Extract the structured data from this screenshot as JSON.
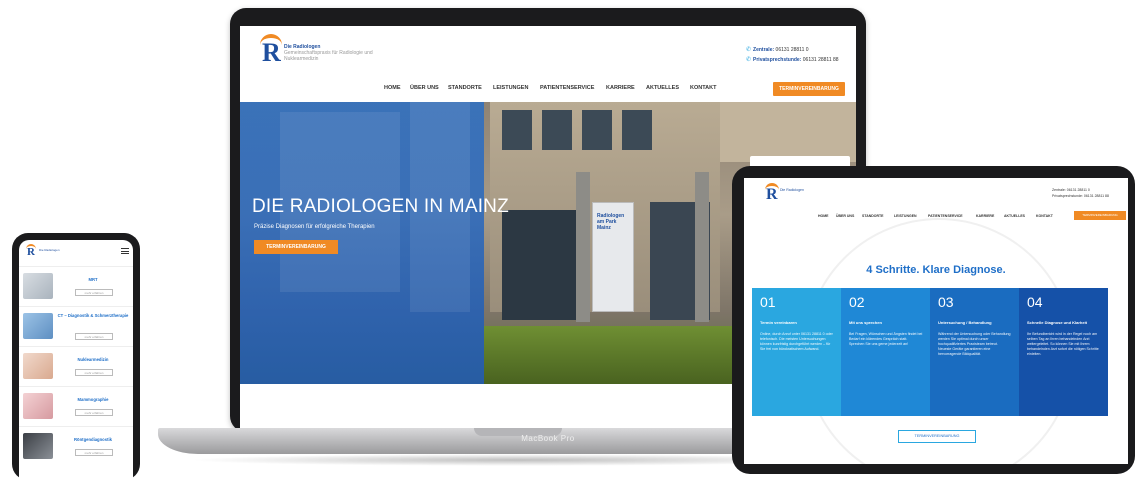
{
  "colors": {
    "brand_blue": "#1f4f9e",
    "accent_orange": "#f08a24",
    "light_blue": "#2aa7e0"
  },
  "laptop": {
    "label": "MacBook Pro",
    "logo": {
      "letter": "R",
      "name": "Die Radiologen",
      "tagline": "Gemeinschaftspraxis für Radiologie und Nuklearmedizin"
    },
    "contact": {
      "zentrale_label": "Zentrale:",
      "zentrale_number": "06131 28811 0",
      "privat_label": "Privatsprechstunde:",
      "privat_number": "06131 28811 88"
    },
    "nav": [
      "HOME",
      "ÜBER UNS",
      "STANDORTE",
      "LEISTUNGEN",
      "PATIENTENSERVICE",
      "KARRIERE",
      "AKTUELLES",
      "KONTAKT"
    ],
    "nav_cta": "TERMINVEREINBARUNG",
    "hero": {
      "title": "DIE RADIOLOGEN IN MAINZ",
      "subtitle": "Präzise Diagnosen für erfolgreiche Therapien",
      "button": "TERMINVEREINBARUNG",
      "sign_text": "Radiologen am Park Mainz"
    }
  },
  "tablet": {
    "logo": {
      "letter": "R",
      "name": "Die Radiologen"
    },
    "contact": {
      "zentrale": "Zentrale: 06131 28811 0",
      "privat": "Privatsprechstunde: 06131 28811 88"
    },
    "nav": [
      "HOME",
      "ÜBER UNS",
      "STANDORTE",
      "LEISTUNGEN",
      "PATIENTENSERVICE",
      "KARRIERE",
      "AKTUELLES",
      "KONTAKT"
    ],
    "nav_cta": "TERMINVEREINBARUNG",
    "heading": "4 Schritte. Klare Diagnose.",
    "steps": [
      {
        "num": "01",
        "title": "Termin vereinbaren",
        "text": "Online, durch Anruf unter 06131 28811 0 oder telefonisch. Die meisten Untersuchungen können kurzfristig durchgeführt werden – für Sie frei von bürokratischem Aufwand.",
        "color": "#2aa7e0"
      },
      {
        "num": "02",
        "title": "Mit uns sprechen",
        "text": "Bei Fragen, Wünschen und Ängsten findet bei Bedarf ein klärendes Gespräch statt. Sprechen Sie uns gerne jederzeit an!",
        "color": "#1f88d6"
      },
      {
        "num": "03",
        "title": "Untersuchung / Behandlung",
        "text": "Während der Untersuchung oder Behandlung werden Sie optimal durch unser hochqualifiziertes Praxisteam betreut. Neueste Geräte garantieren eine hervorragende Bildqualität.",
        "color": "#1a6cc0"
      },
      {
        "num": "04",
        "title": "Schnelle Diagnose und Klarheit",
        "text": "Ihr Befundbericht wird in der Regel noch am selben Tag an Ihren behandelnden Arzt weitergeleitet. So können Sie mit Ihrem behandelnden Arzt sofort die nötigen Schritte einleiten.",
        "color": "#1551a8"
      }
    ],
    "button": "TERMINVEREINBARUNG"
  },
  "phone": {
    "logo": {
      "letter": "R",
      "name": "Die Radiologen"
    },
    "items": [
      {
        "title": "MRT",
        "more": "mehr erfahren"
      },
      {
        "title": "CT – Diagnostik & Schmerztherapie",
        "more": "mehr erfahren"
      },
      {
        "title": "Nuklearmedizin",
        "more": "mehr erfahren"
      },
      {
        "title": "Mammographie",
        "more": "mehr erfahren"
      },
      {
        "title": "Röntgendiagnostik",
        "more": "mehr erfahren"
      }
    ]
  }
}
